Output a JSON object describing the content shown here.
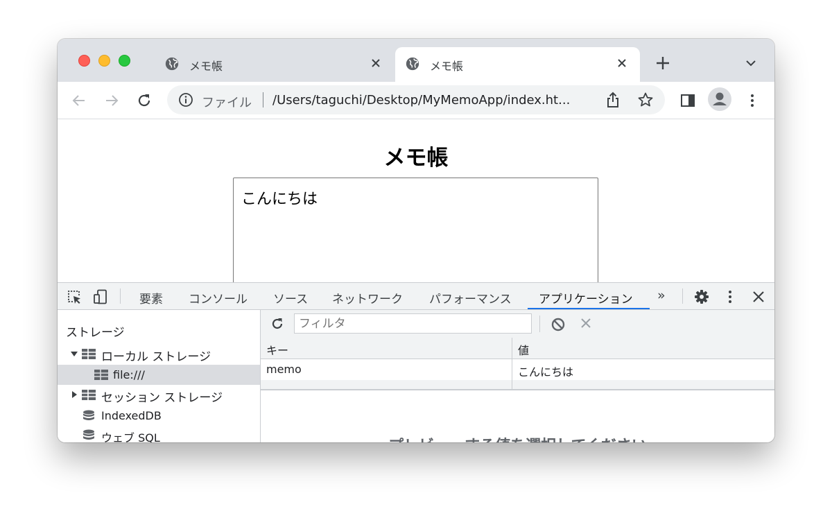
{
  "tabs": [
    {
      "title": "メモ帳",
      "active": false
    },
    {
      "title": "メモ帳",
      "active": true
    }
  ],
  "toolbar": {
    "scheme_label": "ファイル",
    "url": "/Users/taguchi/Desktop/MyMemoApp/index.ht..."
  },
  "page": {
    "title": "メモ帳",
    "memo_text": "こんにちは"
  },
  "devtools": {
    "tabs": [
      "要素",
      "コンソール",
      "ソース",
      "ネットワーク",
      "パフォーマンス",
      "アプリケーション"
    ],
    "active_tab": "アプリケーション",
    "more_tabs": "»",
    "sidebar": {
      "heading": "ストレージ",
      "items": [
        {
          "label": "ローカル ストレージ",
          "expanded": true,
          "icon": "table-icon"
        },
        {
          "label": "file:///",
          "selected": true,
          "icon": "table-icon"
        },
        {
          "label": "セッション ストレージ",
          "expanded": false,
          "icon": "table-icon"
        },
        {
          "label": "IndexedDB",
          "icon": "database-icon"
        },
        {
          "label": "ウェブ SQL",
          "icon": "database-icon"
        }
      ]
    },
    "filter": {
      "placeholder": "フィルタ"
    },
    "table": {
      "headers": {
        "key": "キー",
        "value": "値"
      },
      "rows": [
        {
          "key": "memo",
          "value": "こんにちは"
        }
      ]
    },
    "preview_message": "プレビューする値を選択してください"
  },
  "colors": {
    "accent": "#1a73e8",
    "tabstrip": "#dee1e6",
    "close_red": "#fe5f57",
    "minimize_yellow": "#febc2e",
    "zoom_green": "#28c840"
  }
}
